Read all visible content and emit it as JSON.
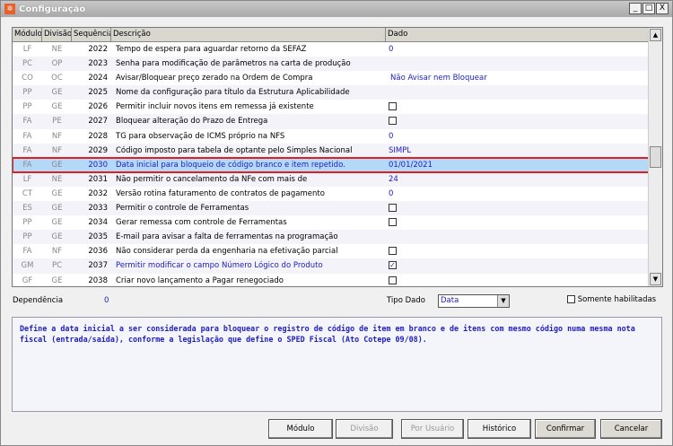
{
  "window": {
    "title": "Configuração",
    "minimize": "_",
    "maximize": "□",
    "close": "X"
  },
  "columns": [
    "Módulo",
    "Divisão",
    "Sequência",
    "Descrição",
    "Dado"
  ],
  "rows": [
    {
      "modulo": "LF",
      "divisao": "NE",
      "seq": "2022",
      "descricao": "Tempo de espera para aguardar retorno da SEFAZ",
      "dado": "0"
    },
    {
      "modulo": "PC",
      "divisao": "OP",
      "seq": "2023",
      "descricao": "Senha para modificação de parâmetros na carta de produção",
      "dado": ""
    },
    {
      "modulo": "CO",
      "divisao": "OC",
      "seq": "2024",
      "descricao": "Avisar/Bloquear preço zerado na Ordem de Compra",
      "dado": "Não Avisar nem Bloquear"
    },
    {
      "modulo": "PP",
      "divisao": "GE",
      "seq": "2025",
      "descricao": "Nome da configuração para título da Estrutura Aplicabilidade",
      "dado": ""
    },
    {
      "modulo": "PP",
      "divisao": "GE",
      "seq": "2026",
      "descricao": "Permitir incluir novos itens em remessa já existente",
      "checkbox": false
    },
    {
      "modulo": "FA",
      "divisao": "PE",
      "seq": "2027",
      "descricao": "Bloquear alteração do Prazo de Entrega",
      "checkbox": false
    },
    {
      "modulo": "FA",
      "divisao": "NF",
      "seq": "2028",
      "descricao": "TG para observação de ICMS próprio na NFS",
      "dado": "0"
    },
    {
      "modulo": "FA",
      "divisao": "NF",
      "seq": "2029",
      "descricao": "Código imposto para tabela de optante pelo Simples Nacional",
      "dado": "SIMPL"
    },
    {
      "modulo": "FA",
      "divisao": "GE",
      "seq": "2030",
      "descricao": "Data inicial para bloqueio de código branco e item repetido.",
      "dado": "01/01/2021",
      "selected": true
    },
    {
      "modulo": "LF",
      "divisao": "NE",
      "seq": "2031",
      "descricao": "Não permitir o cancelamento da NFe com mais de",
      "dado": "24"
    },
    {
      "modulo": "CT",
      "divisao": "GE",
      "seq": "2032",
      "descricao": "Versão rotina faturamento de contratos de pagamento",
      "dado": "0"
    },
    {
      "modulo": "ES",
      "divisao": "GE",
      "seq": "2033",
      "descricao": "Permitir o controle de Ferramentas",
      "checkbox": false
    },
    {
      "modulo": "PP",
      "divisao": "GE",
      "seq": "2034",
      "descricao": "Gerar remessa com controle de Ferramentas",
      "checkbox": false
    },
    {
      "modulo": "PP",
      "divisao": "GE",
      "seq": "2035",
      "descricao": "E-mail para avisar a falta de ferramentas na programação",
      "dado": ""
    },
    {
      "modulo": "FA",
      "divisao": "NF",
      "seq": "2036",
      "descricao": "Não considerar perda da engenharia na efetivação parcial",
      "checkbox": false
    },
    {
      "modulo": "GM",
      "divisao": "PC",
      "seq": "2037",
      "descricao": "Permitir modificar o campo Número Lógico do Produto",
      "checkbox": true,
      "blue": true
    },
    {
      "modulo": "GF",
      "divisao": "GE",
      "seq": "2038",
      "descricao": "Criar novo lançamento a Pagar renegociado",
      "checkbox": false
    }
  ],
  "footer": {
    "dependencia_label": "Dependência",
    "dependencia_value": "0",
    "tipo_dado_label": "Tipo Dado",
    "tipo_dado_value": "Data",
    "somente_habilitadas": "Somente habilitadas"
  },
  "description": "Define a data inicial a ser considerada para bloquear o registro de código de item em branco e de itens com mesmo código numa mesma nota fiscal (entrada/saída), conforme a legislação que define o SPED Fiscal (Ato Cotepe 09/08).",
  "buttons": {
    "modulo": "Módulo",
    "divisao": "Divisão",
    "por_usuario": "Por Usuário",
    "historico": "Histórico",
    "confirmar": "Confirmar",
    "cancelar": "Cancelar"
  }
}
